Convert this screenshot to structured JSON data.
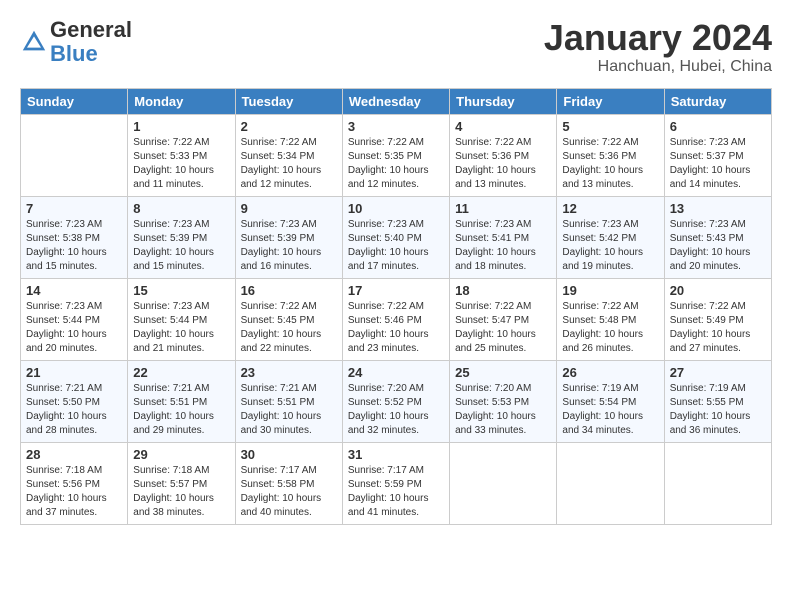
{
  "header": {
    "logo_general": "General",
    "logo_blue": "Blue",
    "month_title": "January 2024",
    "location": "Hanchuan, Hubei, China"
  },
  "calendar": {
    "days_of_week": [
      "Sunday",
      "Monday",
      "Tuesday",
      "Wednesday",
      "Thursday",
      "Friday",
      "Saturday"
    ],
    "weeks": [
      [
        {
          "day": "",
          "sunrise": "",
          "sunset": "",
          "daylight": ""
        },
        {
          "day": "1",
          "sunrise": "Sunrise: 7:22 AM",
          "sunset": "Sunset: 5:33 PM",
          "daylight": "Daylight: 10 hours and 11 minutes."
        },
        {
          "day": "2",
          "sunrise": "Sunrise: 7:22 AM",
          "sunset": "Sunset: 5:34 PM",
          "daylight": "Daylight: 10 hours and 12 minutes."
        },
        {
          "day": "3",
          "sunrise": "Sunrise: 7:22 AM",
          "sunset": "Sunset: 5:35 PM",
          "daylight": "Daylight: 10 hours and 12 minutes."
        },
        {
          "day": "4",
          "sunrise": "Sunrise: 7:22 AM",
          "sunset": "Sunset: 5:36 PM",
          "daylight": "Daylight: 10 hours and 13 minutes."
        },
        {
          "day": "5",
          "sunrise": "Sunrise: 7:22 AM",
          "sunset": "Sunset: 5:36 PM",
          "daylight": "Daylight: 10 hours and 13 minutes."
        },
        {
          "day": "6",
          "sunrise": "Sunrise: 7:23 AM",
          "sunset": "Sunset: 5:37 PM",
          "daylight": "Daylight: 10 hours and 14 minutes."
        }
      ],
      [
        {
          "day": "7",
          "sunrise": "Sunrise: 7:23 AM",
          "sunset": "Sunset: 5:38 PM",
          "daylight": "Daylight: 10 hours and 15 minutes."
        },
        {
          "day": "8",
          "sunrise": "Sunrise: 7:23 AM",
          "sunset": "Sunset: 5:39 PM",
          "daylight": "Daylight: 10 hours and 15 minutes."
        },
        {
          "day": "9",
          "sunrise": "Sunrise: 7:23 AM",
          "sunset": "Sunset: 5:39 PM",
          "daylight": "Daylight: 10 hours and 16 minutes."
        },
        {
          "day": "10",
          "sunrise": "Sunrise: 7:23 AM",
          "sunset": "Sunset: 5:40 PM",
          "daylight": "Daylight: 10 hours and 17 minutes."
        },
        {
          "day": "11",
          "sunrise": "Sunrise: 7:23 AM",
          "sunset": "Sunset: 5:41 PM",
          "daylight": "Daylight: 10 hours and 18 minutes."
        },
        {
          "day": "12",
          "sunrise": "Sunrise: 7:23 AM",
          "sunset": "Sunset: 5:42 PM",
          "daylight": "Daylight: 10 hours and 19 minutes."
        },
        {
          "day": "13",
          "sunrise": "Sunrise: 7:23 AM",
          "sunset": "Sunset: 5:43 PM",
          "daylight": "Daylight: 10 hours and 20 minutes."
        }
      ],
      [
        {
          "day": "14",
          "sunrise": "Sunrise: 7:23 AM",
          "sunset": "Sunset: 5:44 PM",
          "daylight": "Daylight: 10 hours and 20 minutes."
        },
        {
          "day": "15",
          "sunrise": "Sunrise: 7:23 AM",
          "sunset": "Sunset: 5:44 PM",
          "daylight": "Daylight: 10 hours and 21 minutes."
        },
        {
          "day": "16",
          "sunrise": "Sunrise: 7:22 AM",
          "sunset": "Sunset: 5:45 PM",
          "daylight": "Daylight: 10 hours and 22 minutes."
        },
        {
          "day": "17",
          "sunrise": "Sunrise: 7:22 AM",
          "sunset": "Sunset: 5:46 PM",
          "daylight": "Daylight: 10 hours and 23 minutes."
        },
        {
          "day": "18",
          "sunrise": "Sunrise: 7:22 AM",
          "sunset": "Sunset: 5:47 PM",
          "daylight": "Daylight: 10 hours and 25 minutes."
        },
        {
          "day": "19",
          "sunrise": "Sunrise: 7:22 AM",
          "sunset": "Sunset: 5:48 PM",
          "daylight": "Daylight: 10 hours and 26 minutes."
        },
        {
          "day": "20",
          "sunrise": "Sunrise: 7:22 AM",
          "sunset": "Sunset: 5:49 PM",
          "daylight": "Daylight: 10 hours and 27 minutes."
        }
      ],
      [
        {
          "day": "21",
          "sunrise": "Sunrise: 7:21 AM",
          "sunset": "Sunset: 5:50 PM",
          "daylight": "Daylight: 10 hours and 28 minutes."
        },
        {
          "day": "22",
          "sunrise": "Sunrise: 7:21 AM",
          "sunset": "Sunset: 5:51 PM",
          "daylight": "Daylight: 10 hours and 29 minutes."
        },
        {
          "day": "23",
          "sunrise": "Sunrise: 7:21 AM",
          "sunset": "Sunset: 5:51 PM",
          "daylight": "Daylight: 10 hours and 30 minutes."
        },
        {
          "day": "24",
          "sunrise": "Sunrise: 7:20 AM",
          "sunset": "Sunset: 5:52 PM",
          "daylight": "Daylight: 10 hours and 32 minutes."
        },
        {
          "day": "25",
          "sunrise": "Sunrise: 7:20 AM",
          "sunset": "Sunset: 5:53 PM",
          "daylight": "Daylight: 10 hours and 33 minutes."
        },
        {
          "day": "26",
          "sunrise": "Sunrise: 7:19 AM",
          "sunset": "Sunset: 5:54 PM",
          "daylight": "Daylight: 10 hours and 34 minutes."
        },
        {
          "day": "27",
          "sunrise": "Sunrise: 7:19 AM",
          "sunset": "Sunset: 5:55 PM",
          "daylight": "Daylight: 10 hours and 36 minutes."
        }
      ],
      [
        {
          "day": "28",
          "sunrise": "Sunrise: 7:18 AM",
          "sunset": "Sunset: 5:56 PM",
          "daylight": "Daylight: 10 hours and 37 minutes."
        },
        {
          "day": "29",
          "sunrise": "Sunrise: 7:18 AM",
          "sunset": "Sunset: 5:57 PM",
          "daylight": "Daylight: 10 hours and 38 minutes."
        },
        {
          "day": "30",
          "sunrise": "Sunrise: 7:17 AM",
          "sunset": "Sunset: 5:58 PM",
          "daylight": "Daylight: 10 hours and 40 minutes."
        },
        {
          "day": "31",
          "sunrise": "Sunrise: 7:17 AM",
          "sunset": "Sunset: 5:59 PM",
          "daylight": "Daylight: 10 hours and 41 minutes."
        },
        {
          "day": "",
          "sunrise": "",
          "sunset": "",
          "daylight": ""
        },
        {
          "day": "",
          "sunrise": "",
          "sunset": "",
          "daylight": ""
        },
        {
          "day": "",
          "sunrise": "",
          "sunset": "",
          "daylight": ""
        }
      ]
    ]
  }
}
